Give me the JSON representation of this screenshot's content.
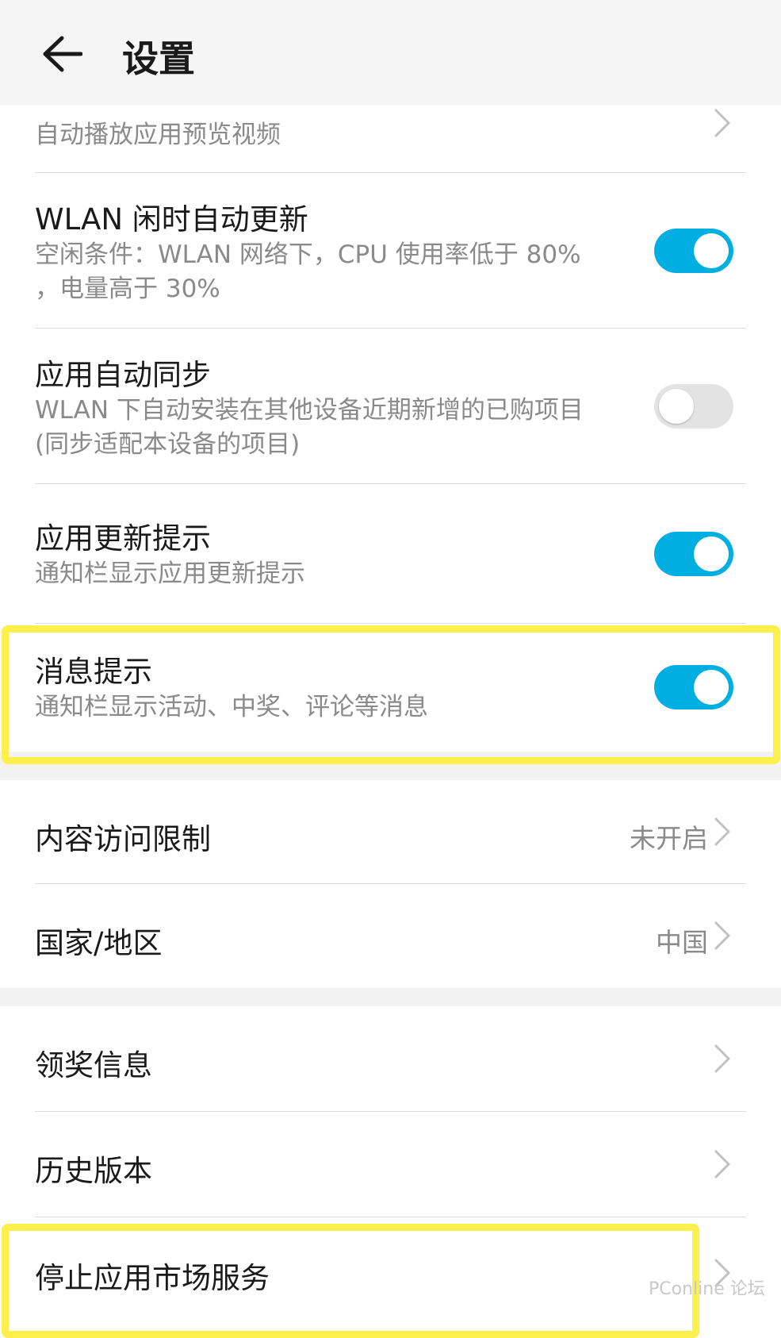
{
  "header": {
    "title": "设置",
    "back_icon": "arrow-left-icon"
  },
  "section1": {
    "partial_row_subtitle": "自动播放应用预览视频",
    "wlan_update": {
      "title": "WLAN 闲时自动更新",
      "subtitle": "空闲条件：WLAN 网络下，CPU 使用率低于 80% ，电量高于 30%",
      "enabled": true
    },
    "auto_sync": {
      "title": "应用自动同步",
      "subtitle": "WLAN 下自动安装在其他设备近期新增的已购项目 (同步适配本设备的项目)",
      "enabled": false
    },
    "update_hint": {
      "title": "应用更新提示",
      "subtitle": "通知栏显示应用更新提示",
      "enabled": true
    },
    "message_hint": {
      "title": "消息提示",
      "subtitle": "通知栏显示活动、中奖、评论等消息",
      "enabled": true
    }
  },
  "section2": {
    "content_restriction": {
      "title": "内容访问限制",
      "value": "未开启"
    },
    "country_region": {
      "title": "国家/地区",
      "value": "中国"
    }
  },
  "section3": {
    "prize_info": {
      "title": "领奖信息"
    },
    "history_version": {
      "title": "历史版本"
    },
    "stop_service": {
      "title": "停止应用市场服务"
    }
  },
  "colors": {
    "toggle_on": "#00aee2",
    "toggle_off": "#e3e3e3",
    "highlight": "#fdf04d"
  },
  "watermark": "PConline 论坛"
}
